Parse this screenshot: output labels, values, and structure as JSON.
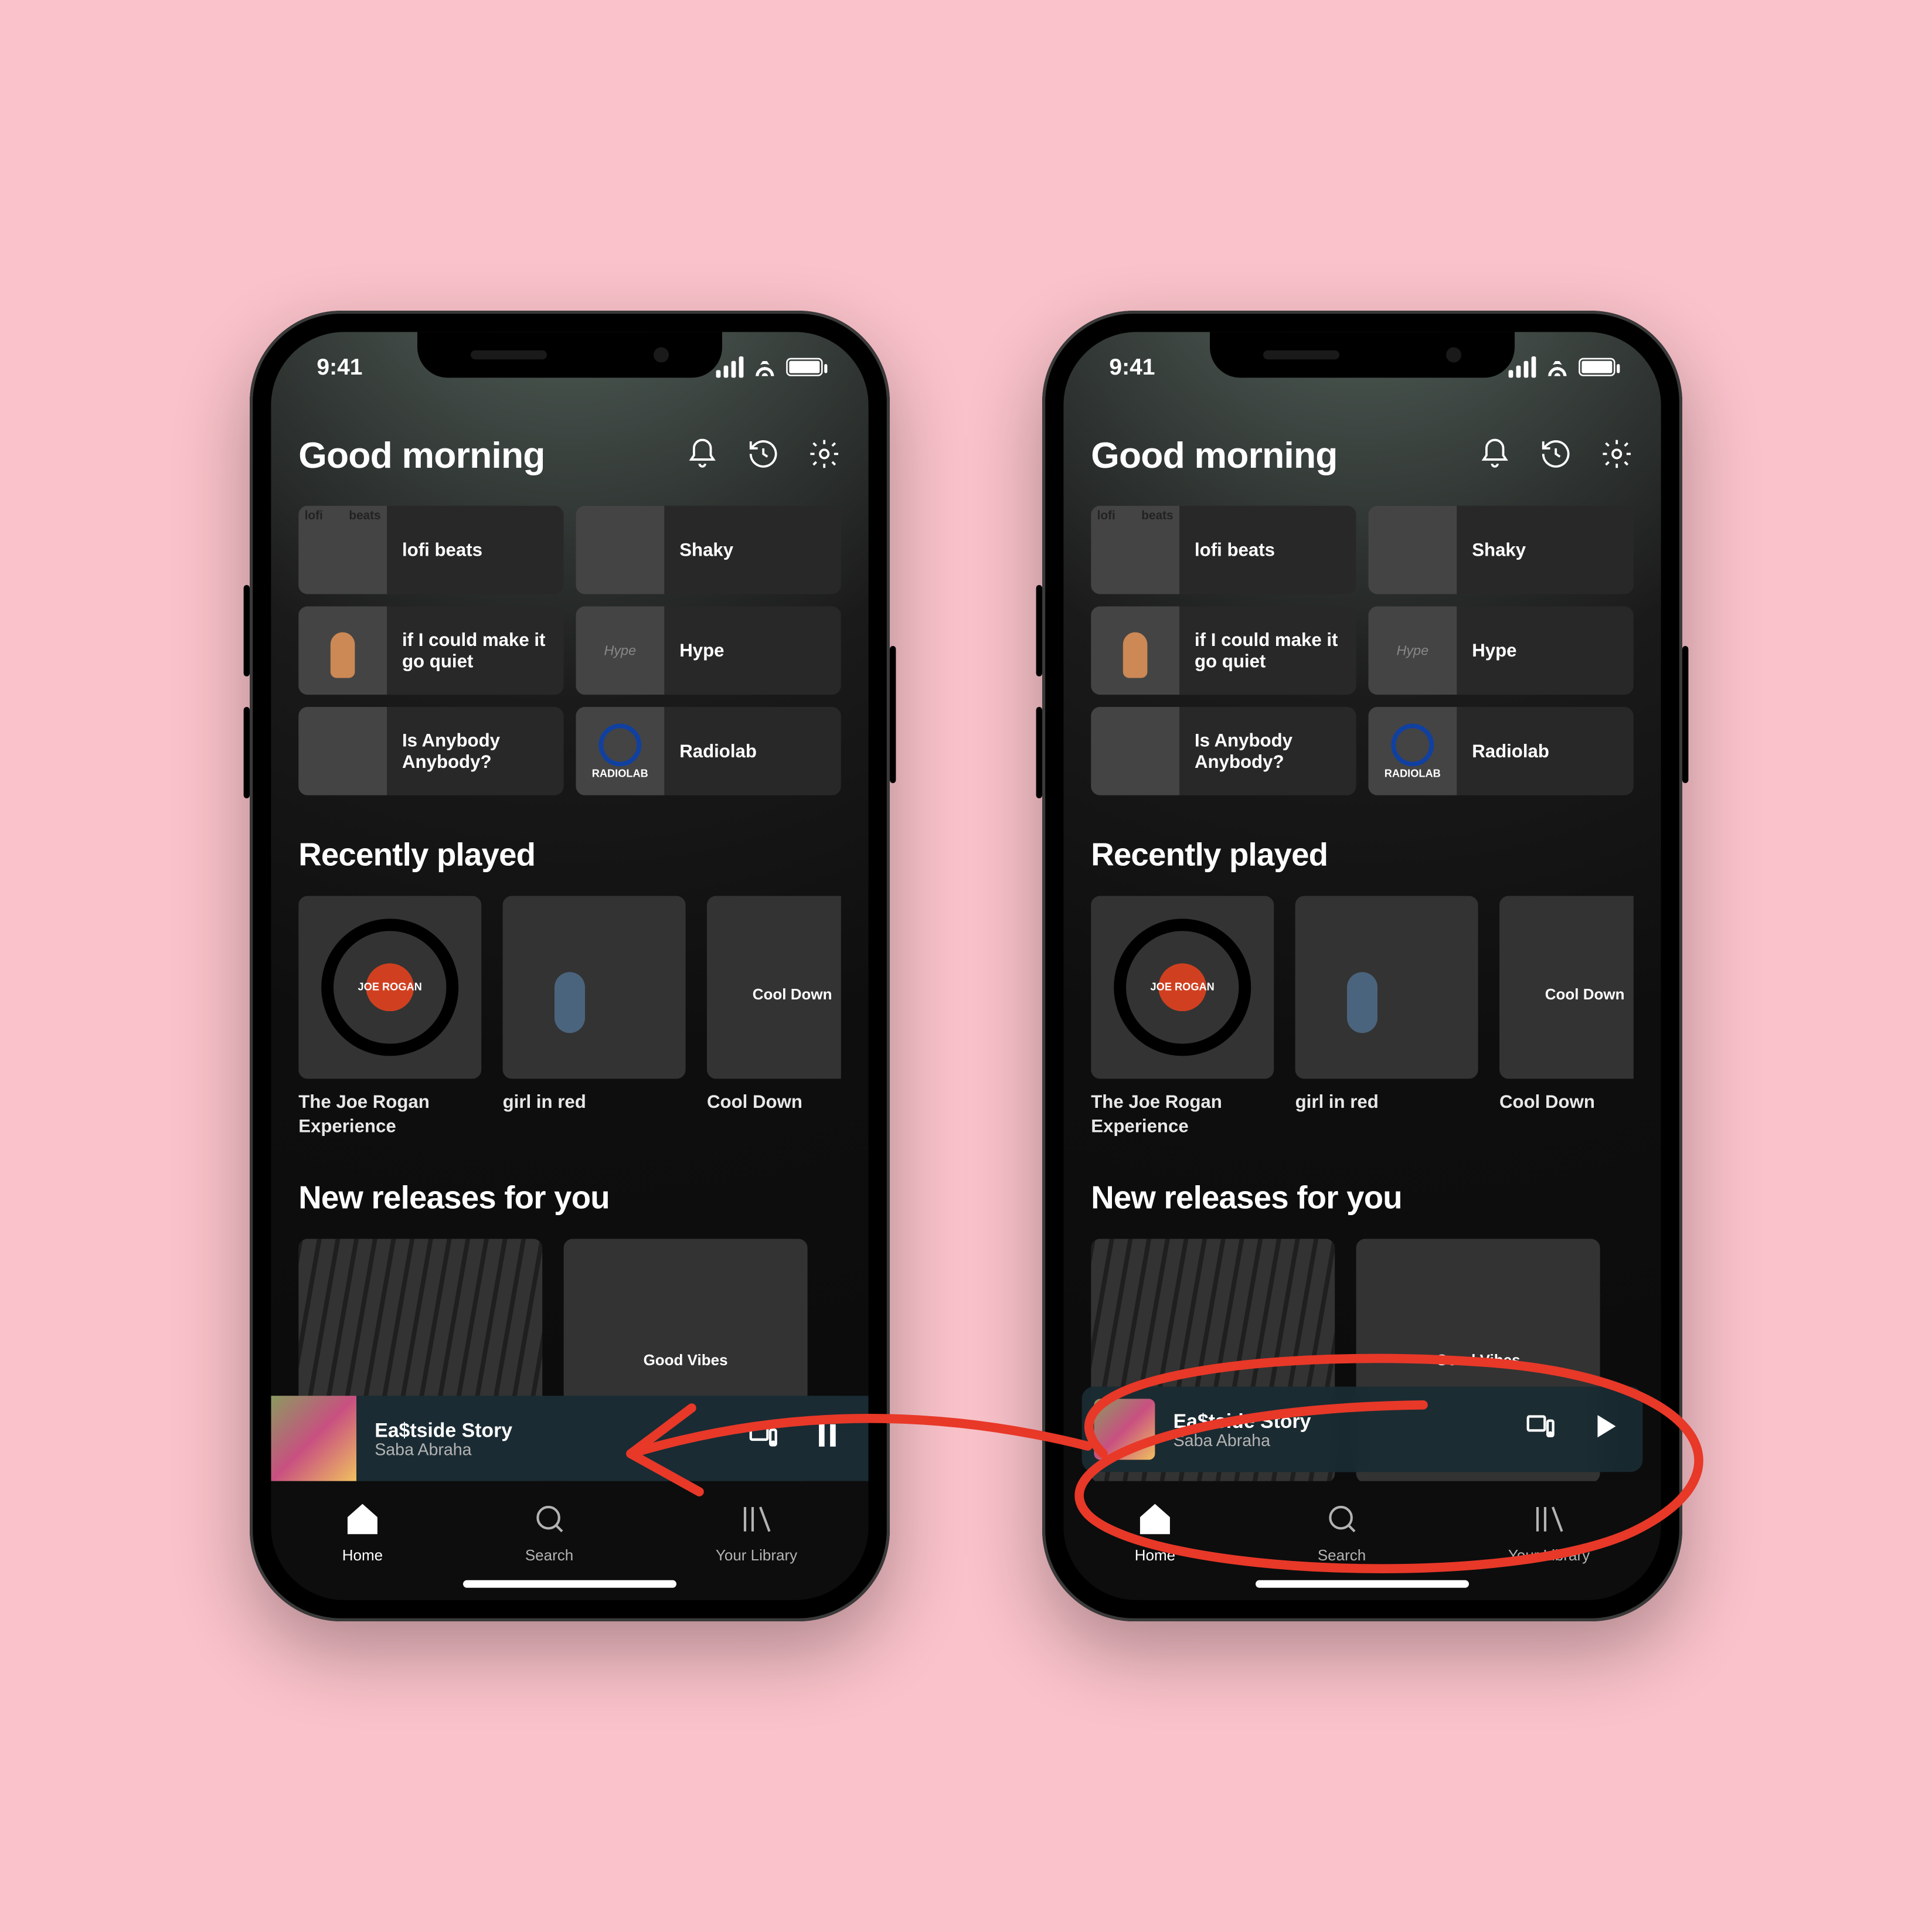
{
  "status": {
    "time": "9:41"
  },
  "header": {
    "title": "Good morning",
    "icons": [
      "bell-icon",
      "history-icon",
      "settings-icon"
    ]
  },
  "shortcuts": [
    {
      "label": "lofi beats",
      "art": "art-lofi"
    },
    {
      "label": "Shaky",
      "art": "art-shaky"
    },
    {
      "label": "if I could make it go quiet",
      "art": "art-quiet"
    },
    {
      "label": "Hype",
      "art": "art-hype"
    },
    {
      "label": "Is Anybody Anybody?",
      "art": "art-anybody"
    },
    {
      "label": "Radiolab",
      "art": "art-radiolab"
    }
  ],
  "sections": {
    "recent": {
      "title": "Recently played"
    },
    "new": {
      "title": "New releases for you"
    }
  },
  "recent_items": [
    {
      "title": "The Joe Rogan Experience",
      "cover": "cover-jre"
    },
    {
      "title": "girl in red",
      "cover": "cover-girl"
    },
    {
      "title": "Cool Down",
      "cover": "cover-cooldown",
      "cover_text": "Cool Down"
    }
  ],
  "new_items": [
    {
      "cover": "cover-new1",
      "cover_text": ""
    },
    {
      "cover": "cover-new2",
      "cover_text": "Good Vibes"
    }
  ],
  "now_playing": {
    "track": "Ea$tside Story",
    "artist": "Saba Abraha"
  },
  "tabs": [
    {
      "label": "Home",
      "icon": "home-icon",
      "active": true
    },
    {
      "label": "Search",
      "icon": "search-icon",
      "active": false
    },
    {
      "label": "Your Library",
      "icon": "library-icon",
      "active": false
    }
  ],
  "colors": {
    "background_page": "#fac2ca",
    "now_playing_bg": "#1a2b33",
    "annotation": "#e83828"
  }
}
